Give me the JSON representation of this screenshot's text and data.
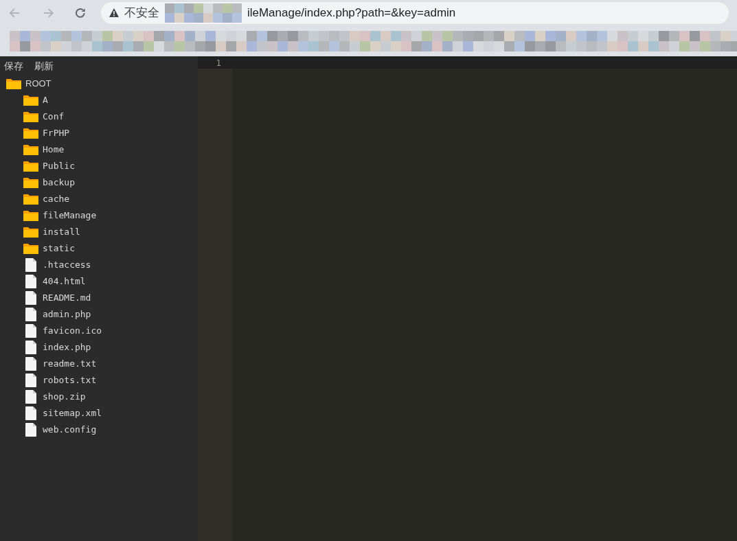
{
  "browser": {
    "security_label": "不安全",
    "url_visible": "ileManage/index.php?path=&key=admin"
  },
  "toolbar": {
    "buttons": [
      "保存",
      "刷新"
    ]
  },
  "tree": {
    "name": "ROOT",
    "kind": "folder",
    "children": [
      {
        "name": "A",
        "kind": "folder"
      },
      {
        "name": "Conf",
        "kind": "folder"
      },
      {
        "name": "FrPHP",
        "kind": "folder"
      },
      {
        "name": "Home",
        "kind": "folder"
      },
      {
        "name": "Public",
        "kind": "folder"
      },
      {
        "name": "backup",
        "kind": "folder"
      },
      {
        "name": "cache",
        "kind": "folder"
      },
      {
        "name": "fileManage",
        "kind": "folder"
      },
      {
        "name": "install",
        "kind": "folder"
      },
      {
        "name": "static",
        "kind": "folder"
      },
      {
        "name": ".htaccess",
        "kind": "file"
      },
      {
        "name": "404.html",
        "kind": "file"
      },
      {
        "name": "README.md",
        "kind": "file"
      },
      {
        "name": "admin.php",
        "kind": "file"
      },
      {
        "name": "favicon.ico",
        "kind": "file"
      },
      {
        "name": "index.php",
        "kind": "file"
      },
      {
        "name": "readme.txt",
        "kind": "file"
      },
      {
        "name": "robots.txt",
        "kind": "file"
      },
      {
        "name": "shop.zip",
        "kind": "file"
      },
      {
        "name": "sitemap.xml",
        "kind": "file"
      },
      {
        "name": "web.config",
        "kind": "file"
      }
    ]
  },
  "editor": {
    "line_numbers": [
      "1"
    ]
  }
}
